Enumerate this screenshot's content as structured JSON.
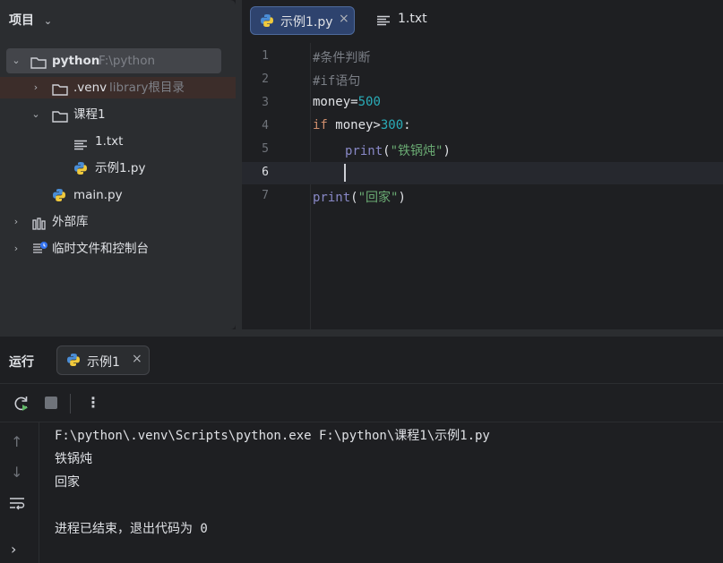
{
  "project": {
    "header": "项目",
    "root": {
      "name": "python",
      "path": "F:\\python"
    },
    "venv": {
      "name": ".venv",
      "hint": "library根目录"
    },
    "course": {
      "name": "课程1"
    },
    "files": [
      "1.txt",
      "示例1.py"
    ],
    "main": "main.py",
    "external": "外部库",
    "scratches": "临时文件和控制台"
  },
  "editor": {
    "tabs": [
      {
        "label": "示例1.py",
        "active": true
      },
      {
        "label": "1.txt",
        "active": false
      }
    ],
    "line_numbers": [
      "1",
      "2",
      "3",
      "4",
      "5",
      "6",
      "7"
    ],
    "code": {
      "l1": "#条件判断",
      "l2": "#if语句",
      "l3_var": "money",
      "l3_op": "=",
      "l3_num": "500",
      "l4_kw": "if",
      "l4_var": " money>",
      "l4_num": "300",
      "l4_colon": ":",
      "l5_fn": "print",
      "l5_open": "(",
      "l5_str": "\"铁锅炖\"",
      "l5_close": ")",
      "l7_fn": "print",
      "l7_open": "(",
      "l7_str": "\"回家\"",
      "l7_close": ")"
    }
  },
  "run": {
    "title": "运行",
    "tab": "示例1",
    "output": [
      "F:\\python\\.venv\\Scripts\\python.exe F:\\python\\课程1\\示例1.py",
      "铁锅炖",
      "回家",
      "",
      "进程已结束，退出代码为 0"
    ]
  },
  "colors": {
    "accent": "#3574f0",
    "selection": "#43454a",
    "keyword": "#cf8e6d",
    "number": "#2aacb8",
    "string": "#6aab73"
  }
}
